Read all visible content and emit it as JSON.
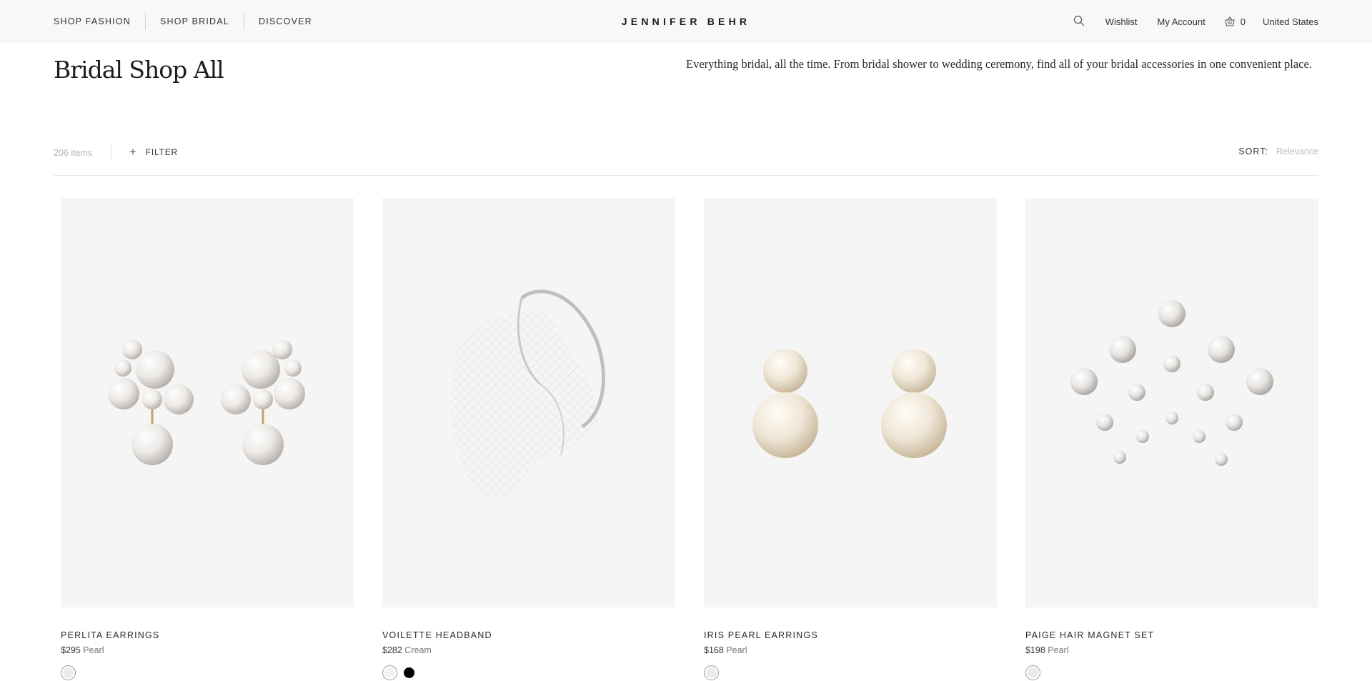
{
  "header": {
    "nav_left": [
      "SHOP FASHION",
      "SHOP BRIDAL",
      "DISCOVER"
    ],
    "logo": "JENNIFER BEHR",
    "search_icon": "search-icon",
    "wishlist": "Wishlist",
    "account": "My Account",
    "cart_icon": "basket-icon",
    "cart_count": "0",
    "region": "United States"
  },
  "page": {
    "title": "Bridal Shop All",
    "description": "Everything bridal, all the time. From bridal shower to wedding ceremony, find all of your bridal accessories in one convenient place."
  },
  "toolbar": {
    "item_count": "206 items",
    "filter_label": "FILTER",
    "sort_label": "SORT:",
    "sort_value": "Relevance"
  },
  "products": [
    {
      "name": "PERLITA EARRINGS",
      "price": "$295",
      "color": "Pearl",
      "swatches": [
        "#f4f1ec"
      ]
    },
    {
      "name": "VOILETTE HEADBAND",
      "price": "$282",
      "color": "Cream",
      "swatches": [
        "#f4f1ec",
        "#000000"
      ]
    },
    {
      "name": "IRIS PEARL EARRINGS",
      "price": "$168",
      "color": "Pearl",
      "swatches": [
        "#f4f1ec"
      ]
    },
    {
      "name": "PAIGE HAIR MAGNET SET",
      "price": "$198",
      "color": "Pearl",
      "swatches": [
        "#f4f1ec"
      ]
    }
  ],
  "colors": {
    "header_bg": "#f9f8f6",
    "card_bg": "#f5f5f5",
    "muted_text": "#b5b5b5"
  }
}
